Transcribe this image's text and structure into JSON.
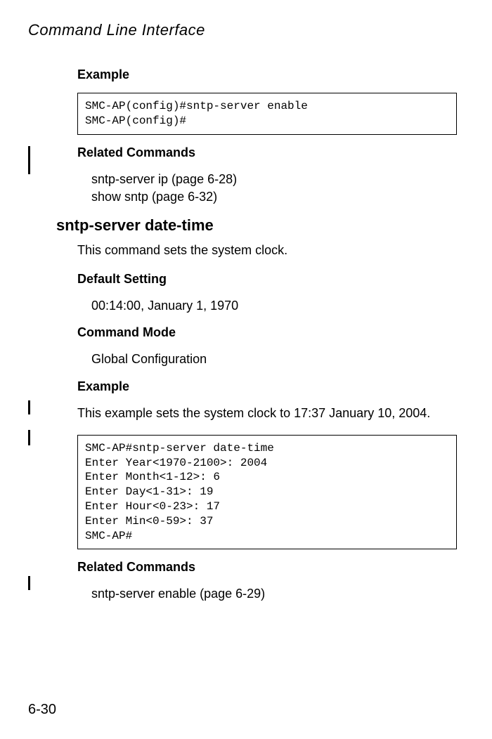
{
  "header": "Command Line Interface",
  "section1": {
    "label": "Example",
    "code": "SMC-AP(config)#sntp-server enable\nSMC-AP(config)#"
  },
  "related1": {
    "label": "Related Commands",
    "line1": "sntp-server ip (page 6-28)",
    "line2": "show sntp (page 6-32)"
  },
  "command": {
    "heading": "sntp-server date-time",
    "description": "This command sets the system clock."
  },
  "default_setting": {
    "label": "Default Setting",
    "value": "00:14:00, January 1, 1970"
  },
  "command_mode": {
    "label": "Command Mode",
    "value": "Global Configuration"
  },
  "section2": {
    "label": "Example",
    "intro": "This example sets the system clock to 17:37 January 10, 2004.",
    "code": "SMC-AP#sntp-server date-time\nEnter Year<1970-2100>: 2004\nEnter Month<1-12>: 6\nEnter Day<1-31>: 19\nEnter Hour<0-23>: 17\nEnter Min<0-59>: 37\nSMC-AP#"
  },
  "related2": {
    "label": "Related Commands",
    "line1": "sntp-server enable (page 6-29)"
  },
  "page_number": "6-30"
}
